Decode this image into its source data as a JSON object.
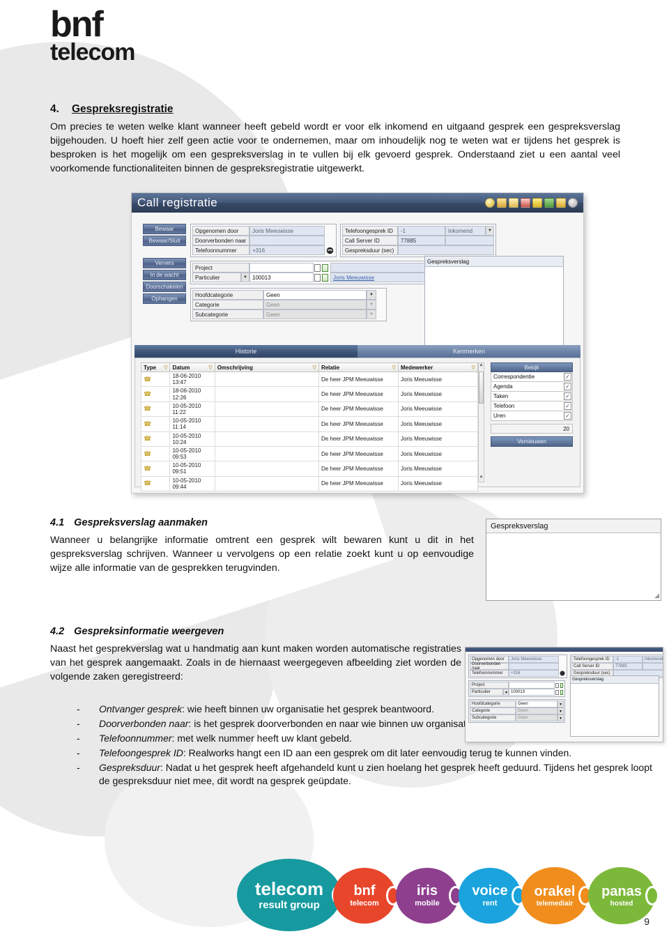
{
  "brand": {
    "line1": "bnf",
    "line2": "telecom"
  },
  "section": {
    "number": "4.",
    "title": "Gespreksregistratie",
    "paragraph": "Om precies te weten welke klant wanneer heeft gebeld wordt er voor elk inkomend en uitgaand gesprek een gespreksverslag bijgehouden. U hoeft hier zelf geen actie voor te ondernemen, maar om inhoudelijk nog te weten wat er tijdens het gesprek is besproken is het mogelijk om een gespreksverslag in te vullen bij elk gevoerd gesprek. Onderstaand ziet u een aantal veel voorkomende functionaliteiten binnen de gespreksregistratie uitgewerkt."
  },
  "screenshot": {
    "window_title": "Call registratie",
    "toolbar_icons": [
      "search-icon",
      "contact-add-icon",
      "contact-icon",
      "calendar-icon",
      "edit-icon",
      "refresh-icon",
      "note-icon",
      "help-icon"
    ],
    "buttons": [
      "Bewaar",
      "Bewaar/Sluit",
      "Ververs",
      "In de wacht",
      "Doorschakelen",
      "Ophangen"
    ],
    "fields": {
      "opgenomen_door_label": "Opgenomen door",
      "opgenomen_door_value": "Joris Meeuwisse",
      "doorverbonden_label": "Doorverbonden naar",
      "doorverbonden_value": "",
      "telefoonnummer_label": "Telefoonnummer",
      "telefoonnummer_value": "+316",
      "telefoongesprek_id_label": "Telefoongesprek ID",
      "telefoongesprek_id_value": "-1",
      "richting_value": "Inkomend",
      "call_server_id_label": "Call Server ID",
      "call_server_id_value": "77885",
      "gespreksduur_label": "Gespreksduur (sec)",
      "gespreksduur_value": "",
      "project_label": "Project",
      "project_value": "",
      "particulier_label": "Particulier",
      "particulier_value": "100013",
      "relatie_link": "Joris Meeuwisse",
      "hoofdcategorie_label": "Hoofdcategorie",
      "hoofdcategorie_value": "Geen",
      "categorie_label": "Categorie",
      "categorie_value": "Geen",
      "subcategorie_label": "Subcategorie",
      "subcategorie_value": "Geen",
      "gespreksverslag_label": "Gespreksverslag"
    },
    "tabs": [
      {
        "label": "Historie",
        "active": true
      },
      {
        "label": "Kenmerken",
        "active": false
      }
    ],
    "table": {
      "columns": [
        "Type",
        "Datum",
        "Omschrijving",
        "Relatie",
        "Medewerker"
      ],
      "rows": [
        {
          "type": "phone-icon",
          "datum": "18-06-2010\n13:47",
          "omschrijving": "",
          "relatie": "De heer JPM Meeuwisse",
          "medewerker": "Joris Meeuwisse"
        },
        {
          "type": "phone-icon",
          "datum": "18-06-2010\n12:26",
          "omschrijving": "",
          "relatie": "De heer JPM Meeuwisse",
          "medewerker": "Joris Meeuwisse"
        },
        {
          "type": "phone-icon",
          "datum": "10-05-2010\n11:22",
          "omschrijving": "",
          "relatie": "De heer JPM Meeuwisse",
          "medewerker": "Joris Meeuwisse"
        },
        {
          "type": "phone-icon",
          "datum": "10-05-2010\n11:14",
          "omschrijving": "",
          "relatie": "De heer JPM Meeuwisse",
          "medewerker": "Joris Meeuwisse"
        },
        {
          "type": "phone-icon",
          "datum": "10-05-2010\n10:24",
          "omschrijving": "",
          "relatie": "De heer JPM Meeuwisse",
          "medewerker": "Joris Meeuwisse"
        },
        {
          "type": "phone-icon",
          "datum": "10-05-2010\n09:53",
          "omschrijving": "",
          "relatie": "De heer JPM Meeuwisse",
          "medewerker": "Joris Meeuwisse"
        },
        {
          "type": "phone-icon",
          "datum": "10-05-2010\n09:51",
          "omschrijving": "",
          "relatie": "De heer JPM Meeuwisse",
          "medewerker": "Joris Meeuwisse"
        },
        {
          "type": "phone-icon",
          "datum": "10-05-2010\n09:44",
          "omschrijving": "",
          "relatie": "De heer JPM Meeuwisse",
          "medewerker": "Joris Meeuwisse"
        }
      ]
    },
    "side_panel": {
      "header": "Bekijk",
      "checkboxes": [
        {
          "label": "Correspondentie",
          "checked": true
        },
        {
          "label": "Agenda",
          "checked": true
        },
        {
          "label": "Taken",
          "checked": true
        },
        {
          "label": "Telefoon",
          "checked": true
        },
        {
          "label": "Uren",
          "checked": true
        }
      ],
      "count_value": "20",
      "refresh_button": "Vernieuwen"
    }
  },
  "sub41": {
    "number": "4.1",
    "title": "Gespreksverslag aanmaken",
    "paragraph": "Wanneer u belangrijke informatie omtrent een gesprek wilt bewaren kunt u dit in het gespreksverslag schrijven. Wanneer u vervolgens op een relatie zoekt kunt u op eenvoudige wijze alle informatie van de gesprekken terugvinden.",
    "box_label": "Gespreksverslag"
  },
  "sub42": {
    "number": "4.2",
    "title": "Gespreksinformatie weergeven",
    "paragraph": "Naast het gesprekverslag wat u handmatig aan kunt maken worden automatische registraties van het gesprek aangemaakt. Zoals in de hiernaast weergegeven afbeelding ziet worden de volgende zaken geregistreerd:",
    "bullets": [
      {
        "dash": "-",
        "term": "Ontvanger gesprek",
        "rest": ": wie heeft binnen uw organisatie het gesprek beantwoord."
      },
      {
        "dash": "-",
        "term": "Doorverbonden naar",
        "rest": ": is het gesprek doorverbonden en naar wie binnen uw organisatie."
      },
      {
        "dash": "-",
        "term": "Telefoonnummer",
        "rest": ": met welk nummer heeft uw klant gebeld."
      },
      {
        "dash": "-",
        "term": "Telefoongesprek ID",
        "rest": ": Realworks hangt een ID aan een gesprek om dit later eenvoudig terug te kunnen vinden."
      },
      {
        "dash": "-",
        "term": "Gespreksduur",
        "rest": ": Nadat u het gesprek heeft afgehandeld kunt u zien hoelang het gesprek heeft geduurd. Tijdens het gesprek loopt de gespreksduur niet mee, dit wordt na gesprek geüpdate."
      }
    ]
  },
  "footer": {
    "page_number": "9",
    "logos": [
      {
        "line1": "telecom",
        "line2": "result group",
        "color": "#169aa0"
      },
      {
        "line1": "bnf",
        "line2": "telecom",
        "color": "#e8462b"
      },
      {
        "line1": "iris",
        "line2": "mobile",
        "color": "#8e3f8e"
      },
      {
        "line1": "voice",
        "line2": "rent",
        "color": "#1aa3dd"
      },
      {
        "line1": "orakel",
        "line2": "telemediair",
        "color": "#f08d1c"
      },
      {
        "line1": "panas",
        "line2": "hosted",
        "color": "#7cb93a"
      }
    ]
  }
}
